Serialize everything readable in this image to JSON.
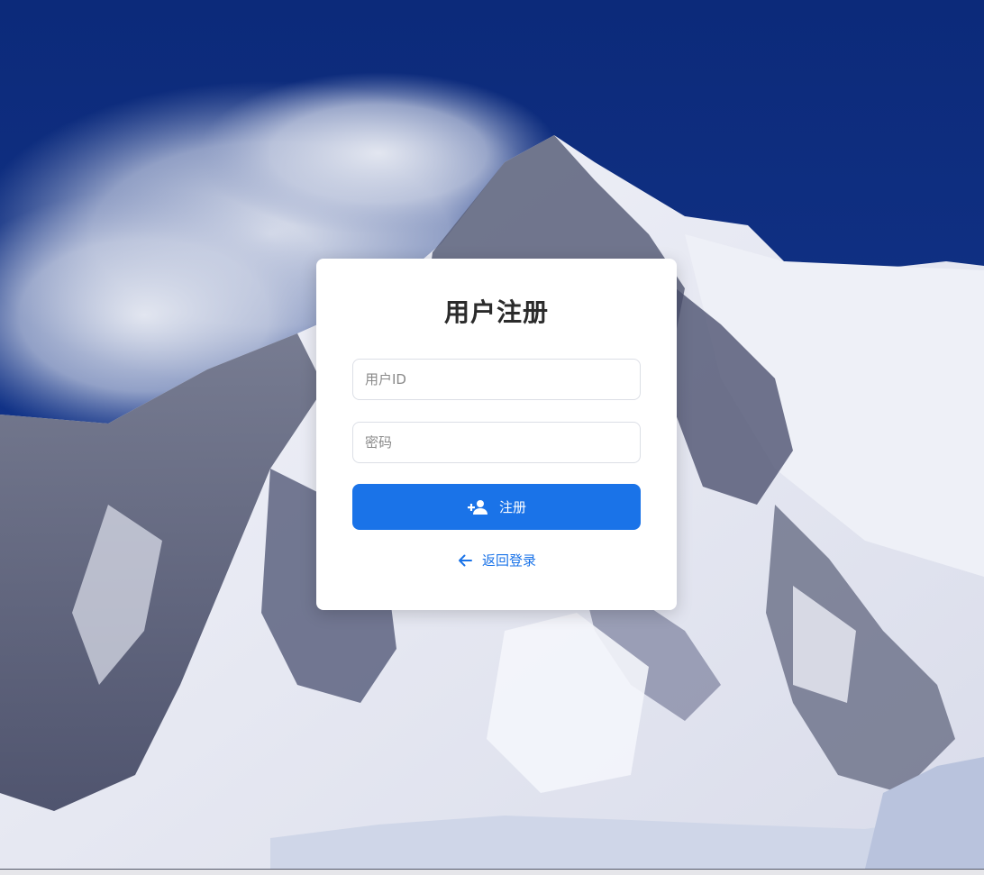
{
  "page": {
    "title": "用户注册",
    "background": "snow-mountain-photo"
  },
  "form": {
    "user_id_placeholder": "用户ID",
    "password_placeholder": "密码",
    "register_label": "注册",
    "register_icon": "person-add-icon",
    "back_label": "返回登录",
    "back_icon": "arrow-left-icon"
  },
  "colors": {
    "primary": "#1a73e8",
    "sky": "#0d2e80",
    "card": "#ffffff",
    "title": "#2b2b2b"
  }
}
